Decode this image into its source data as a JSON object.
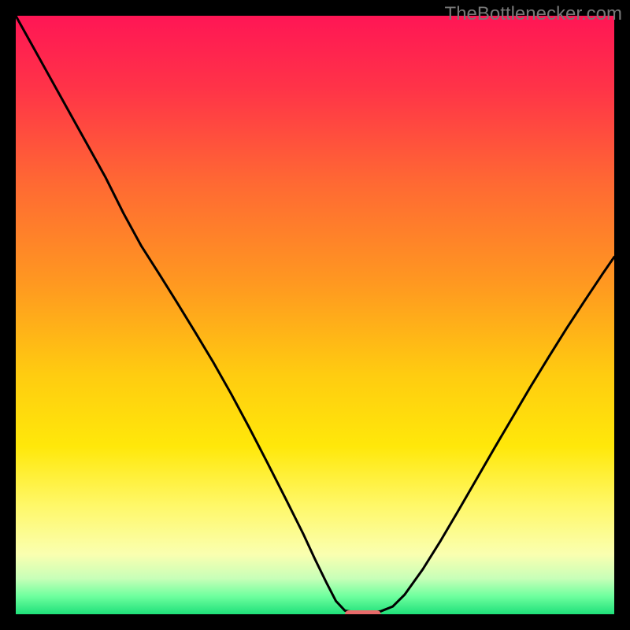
{
  "watermark": "TheBottlenecker.com",
  "chart_data": {
    "type": "line",
    "title": "",
    "xlabel": "",
    "ylabel": "",
    "xlim": [
      0,
      100
    ],
    "ylim": [
      0,
      100
    ],
    "background_gradient": {
      "stops": [
        {
          "offset": 0,
          "color": "#ff1655"
        },
        {
          "offset": 12,
          "color": "#ff3348"
        },
        {
          "offset": 28,
          "color": "#ff6933"
        },
        {
          "offset": 45,
          "color": "#ff9920"
        },
        {
          "offset": 60,
          "color": "#ffcc10"
        },
        {
          "offset": 72,
          "color": "#ffe80a"
        },
        {
          "offset": 82,
          "color": "#fff86a"
        },
        {
          "offset": 90,
          "color": "#faffb0"
        },
        {
          "offset": 94,
          "color": "#c8ffb8"
        },
        {
          "offset": 97,
          "color": "#6eff9e"
        },
        {
          "offset": 100,
          "color": "#1fe07a"
        }
      ]
    },
    "curve": [
      {
        "x": 0,
        "y": 100.0
      },
      {
        "x": 3,
        "y": 94.6
      },
      {
        "x": 6,
        "y": 89.2
      },
      {
        "x": 9,
        "y": 83.8
      },
      {
        "x": 12,
        "y": 78.4
      },
      {
        "x": 15,
        "y": 73.0
      },
      {
        "x": 18,
        "y": 67.0
      },
      {
        "x": 21,
        "y": 61.5
      },
      {
        "x": 24,
        "y": 56.8
      },
      {
        "x": 27,
        "y": 52.0
      },
      {
        "x": 30,
        "y": 47.1
      },
      {
        "x": 33,
        "y": 42.1
      },
      {
        "x": 36,
        "y": 36.8
      },
      {
        "x": 39,
        "y": 31.2
      },
      {
        "x": 42,
        "y": 25.4
      },
      {
        "x": 45,
        "y": 19.5
      },
      {
        "x": 48,
        "y": 13.5
      },
      {
        "x": 50,
        "y": 9.2
      },
      {
        "x": 52,
        "y": 5.1
      },
      {
        "x": 53.5,
        "y": 2.2
      },
      {
        "x": 55,
        "y": 0.6
      },
      {
        "x": 57,
        "y": 0.3
      },
      {
        "x": 59,
        "y": 0.3
      },
      {
        "x": 61,
        "y": 0.5
      },
      {
        "x": 63,
        "y": 1.3
      },
      {
        "x": 65,
        "y": 3.3
      },
      {
        "x": 68,
        "y": 7.5
      },
      {
        "x": 71,
        "y": 12.3
      },
      {
        "x": 74,
        "y": 17.4
      },
      {
        "x": 77,
        "y": 22.6
      },
      {
        "x": 80,
        "y": 27.8
      },
      {
        "x": 83,
        "y": 32.9
      },
      {
        "x": 86,
        "y": 38.0
      },
      {
        "x": 89,
        "y": 42.9
      },
      {
        "x": 92,
        "y": 47.7
      },
      {
        "x": 95,
        "y": 52.3
      },
      {
        "x": 98,
        "y": 56.8
      },
      {
        "x": 100,
        "y": 59.7
      }
    ],
    "marker": {
      "x_start": 55,
      "x_end": 61,
      "y": 0,
      "color": "#e86a6a",
      "thickness_pct": 1.3,
      "radius_pct": 0.65
    }
  }
}
